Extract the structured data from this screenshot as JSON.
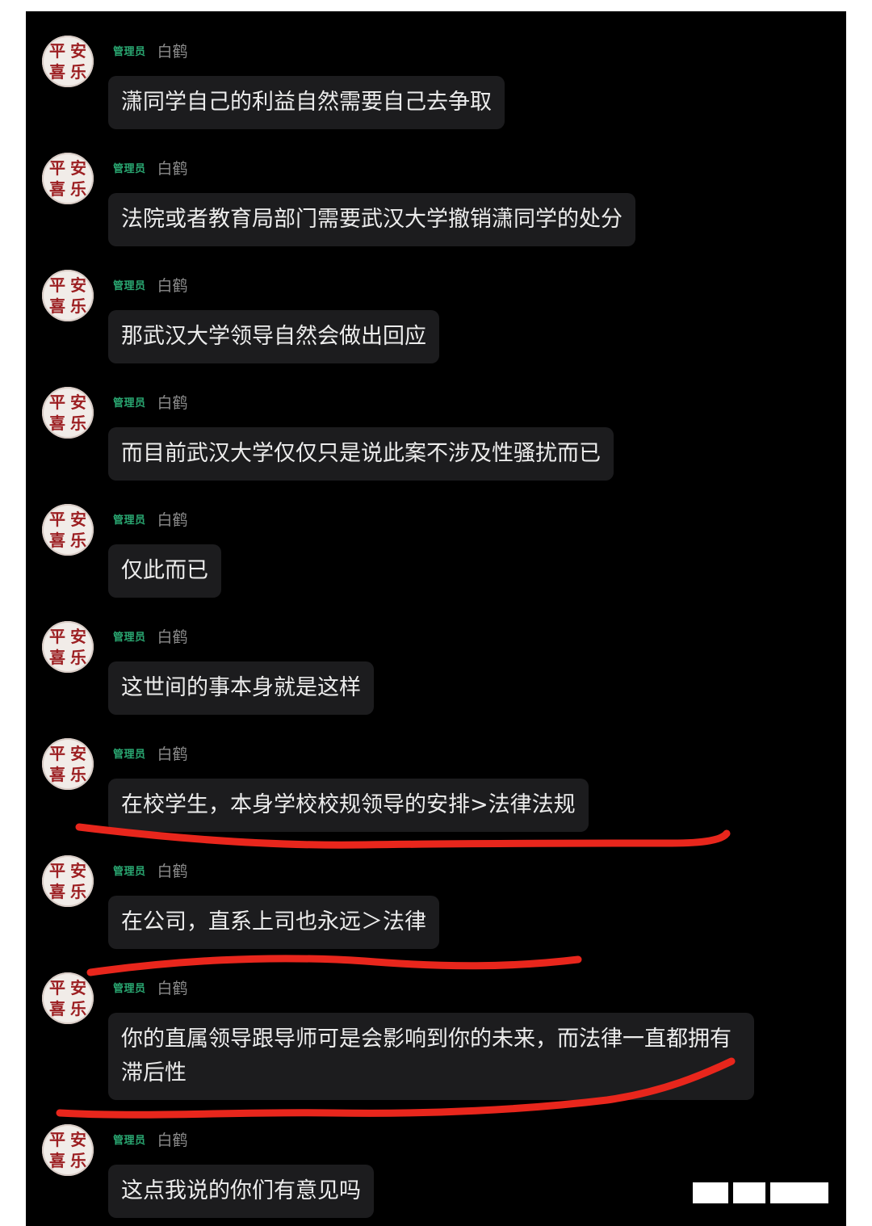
{
  "chat": {
    "messages": [
      {
        "badge": "管理员",
        "sender": "白鹤",
        "text": "潇同学自己的利益自然需要自己去争取"
      },
      {
        "badge": "管理员",
        "sender": "白鹤",
        "text": "法院或者教育局部门需要武汉大学撤销潇同学的处分"
      },
      {
        "badge": "管理员",
        "sender": "白鹤",
        "text": "那武汉大学领导自然会做出回应"
      },
      {
        "badge": "管理员",
        "sender": "白鹤",
        "text": "而目前武汉大学仅仅只是说此案不涉及性骚扰而已"
      },
      {
        "badge": "管理员",
        "sender": "白鹤",
        "text": "仅此而已"
      },
      {
        "badge": "管理员",
        "sender": "白鹤",
        "text": "这世间的事本身就是这样"
      },
      {
        "badge": "管理员",
        "sender": "白鹤",
        "text": "在校学生，本身学校校规领导的安排>法律法规"
      },
      {
        "badge": "管理员",
        "sender": "白鹤",
        "text": "在公司，直系上司也永远＞法律"
      },
      {
        "badge": "管理员",
        "sender": "白鹤",
        "text": "你的直属领导跟导师可是会影响到你的未来，而法律一直都拥有滞后性"
      },
      {
        "badge": "管理员",
        "sender": "白鹤",
        "text": "这点我说的你们有意见吗"
      }
    ],
    "avatar_seal": [
      "平",
      "安",
      "喜",
      "乐"
    ]
  },
  "colors": {
    "background": "#000000",
    "bubble": "#1c1c1e",
    "bubble_text": "#ececec",
    "admin_badge": "#2aa872",
    "sender_name": "#8b8b8b",
    "underline": "#e8261c",
    "seal": "#9c1f22"
  },
  "icons": [
    "avatar-seal"
  ]
}
